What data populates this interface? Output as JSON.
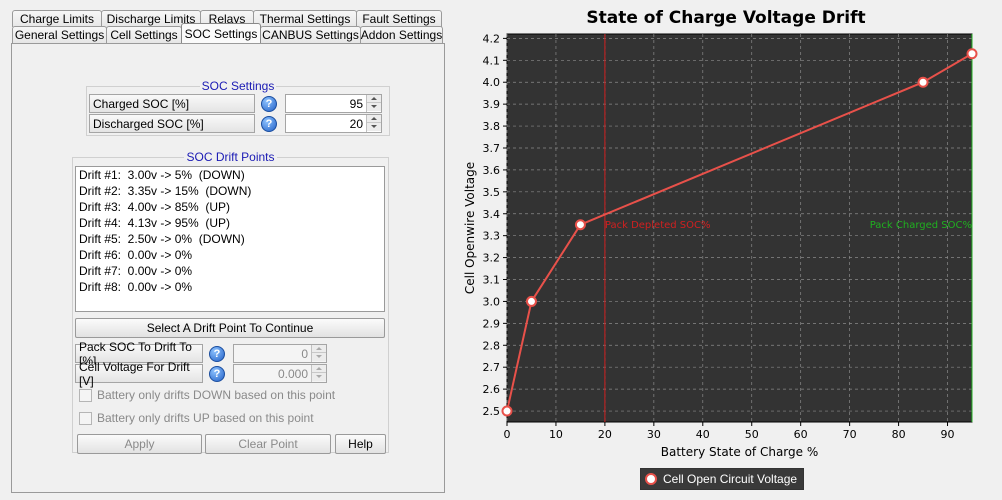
{
  "tabs_row1": [
    "Charge Limits",
    "Discharge Limits",
    "Relays",
    "Thermal Settings",
    "Fault Settings"
  ],
  "tabs_row2": [
    "General Settings",
    "Cell Settings",
    "SOC Settings",
    "CANBUS Settings",
    "Addon Settings"
  ],
  "active_tab": "SOC Settings",
  "soc_settings": {
    "title": "SOC Settings",
    "charged_label": "Charged SOC [%]",
    "charged_value": "95",
    "discharged_label": "Discharged SOC [%]",
    "discharged_value": "20"
  },
  "drift": {
    "title": "SOC Drift Points",
    "items": [
      "Drift #1:  3.00v -> 5%  (DOWN)",
      "Drift #2:  3.35v -> 15%  (DOWN)",
      "Drift #3:  4.00v -> 85%  (UP)",
      "Drift #4:  4.13v -> 95%  (UP)",
      "Drift #5:  2.50v -> 0%  (DOWN)",
      "Drift #6:  0.00v -> 0%",
      "Drift #7:  0.00v -> 0%",
      "Drift #8:  0.00v -> 0%"
    ],
    "select_button": "Select A Drift Point To Continue",
    "pack_label": "Pack SOC To Drift To [%]",
    "pack_value": "0",
    "cell_label": "Cell Voltage For Drift [V]",
    "cell_value": "0.000",
    "down_check": "Battery only drifts DOWN based on this point",
    "up_check": "Battery only drifts UP based on this point",
    "apply": "Apply",
    "clear": "Clear Point",
    "help": "Help"
  },
  "help_icon_glyph": "?",
  "chart_data": {
    "type": "line",
    "title": "State of Charge Voltage Drift",
    "xlabel": "Battery State of Charge %",
    "ylabel": "Cell Openwire Voltage",
    "xlim": [
      0,
      95
    ],
    "ylim": [
      2.45,
      4.22
    ],
    "xticks": [
      0,
      10,
      20,
      30,
      40,
      50,
      60,
      70,
      80,
      90
    ],
    "yticks": [
      "2.5",
      "2.6",
      "2.7",
      "2.8",
      "2.9",
      "3.0",
      "3.1",
      "3.2",
      "3.3",
      "3.4",
      "3.5",
      "3.6",
      "3.7",
      "3.8",
      "3.9",
      "4.0",
      "4.1",
      "4.2"
    ],
    "grid": true,
    "background": "#333333",
    "series": [
      {
        "name": "Cell Open Circuit Voltage",
        "color": "#e8514a",
        "x": [
          0,
          5,
          15,
          85,
          95
        ],
        "y": [
          2.5,
          3.0,
          3.35,
          4.0,
          4.13
        ]
      }
    ],
    "markers": [
      {
        "x": 20,
        "label": "Pack Depleted SOC%",
        "color": "#d02020"
      },
      {
        "x": 95,
        "label": "Pack Charged SOC%",
        "color": "#20b020"
      }
    ],
    "legend": "bottom"
  }
}
